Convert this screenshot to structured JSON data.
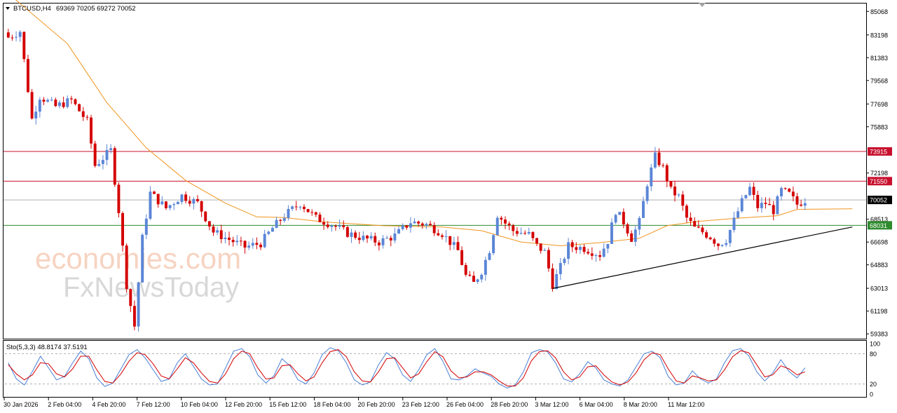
{
  "header": {
    "symbol": "BTCUSD,H4",
    "ohlc": "69369 70205 69272 70052",
    "dropdown_icon": "triangle-down-icon"
  },
  "indicator": {
    "label": "Sto(5,3,3) 48.8174 37.5191"
  },
  "watermark": {
    "line1": "economies.com",
    "line2": "FxNewsToday"
  },
  "colors": {
    "bull": "#5b86d6",
    "bear": "#d40000",
    "ma": "#f0951e",
    "resistance": "#c8102e",
    "support": "#2e8b2e",
    "current": "#b0b0b0",
    "trendline": "#000000",
    "stoch_main": "#4a80d6",
    "stoch_signal": "#d40000"
  },
  "chart_data": [
    {
      "type": "candlestick",
      "symbol": "BTCUSD",
      "timeframe": "H4",
      "y_ticks": [
        85068,
        83198,
        81383,
        79568,
        77698,
        75883,
        72198,
        68513,
        66698,
        64883,
        63013,
        61198,
        59383
      ],
      "ylim": [
        59383,
        85068
      ],
      "x_ticks": [
        "30 Jan 2026",
        "2 Feb 04:00",
        "4 Feb 20:00",
        "7 Feb 12:00",
        "10 Feb 04:00",
        "12 Feb 20:00",
        "15 Feb 12:00",
        "18 Feb 04:00",
        "20 Feb 20:00",
        "23 Feb 12:00",
        "26 Feb 04:00",
        "28 Feb 20:00",
        "3 Mar 12:00",
        "6 Mar 04:00",
        "8 Mar 20:00",
        "11 Mar 12:00"
      ],
      "levels": [
        {
          "label": "73915",
          "value": 73915,
          "role": "resistance"
        },
        {
          "label": "71550",
          "value": 71550,
          "role": "resistance"
        },
        {
          "label": "70052",
          "value": 70052,
          "role": "current"
        },
        {
          "label": "68031",
          "value": 68031,
          "role": "support"
        }
      ],
      "trendline": {
        "from": {
          "bar": 138,
          "price": 63000
        },
        "to": {
          "bar": 214,
          "price": 67900
        }
      },
      "moving_average_path": [
        [
          0,
          86500
        ],
        [
          15,
          82500
        ],
        [
          25,
          77800
        ],
        [
          35,
          74200
        ],
        [
          45,
          71600
        ],
        [
          55,
          69800
        ],
        [
          63,
          68700
        ],
        [
          70,
          68650
        ],
        [
          80,
          68300
        ],
        [
          95,
          68000
        ],
        [
          110,
          67900
        ],
        [
          120,
          67600
        ],
        [
          130,
          66700
        ],
        [
          140,
          66400
        ],
        [
          150,
          66650
        ],
        [
          160,
          67000
        ],
        [
          167,
          68000
        ],
        [
          175,
          68350
        ],
        [
          185,
          68600
        ],
        [
          195,
          68800
        ],
        [
          200,
          69300
        ],
        [
          214,
          69350
        ]
      ],
      "price_path": [
        [
          0,
          83000
        ],
        [
          3,
          83500
        ],
        [
          6,
          76500
        ],
        [
          8,
          78300
        ],
        [
          12,
          77500
        ],
        [
          16,
          78000
        ],
        [
          20,
          76300
        ],
        [
          22,
          72800
        ],
        [
          26,
          74000
        ],
        [
          28,
          69200
        ],
        [
          30,
          63300
        ],
        [
          32,
          60000
        ],
        [
          34,
          67000
        ],
        [
          36,
          70600
        ],
        [
          40,
          69400
        ],
        [
          44,
          70400
        ],
        [
          48,
          69800
        ],
        [
          52,
          67500
        ],
        [
          56,
          66900
        ],
        [
          60,
          66300
        ],
        [
          64,
          66600
        ],
        [
          67,
          67800
        ],
        [
          70,
          68800
        ],
        [
          74,
          69800
        ],
        [
          78,
          68600
        ],
        [
          82,
          68100
        ],
        [
          86,
          67400
        ],
        [
          90,
          67000
        ],
        [
          94,
          66700
        ],
        [
          98,
          67200
        ],
        [
          102,
          68300
        ],
        [
          106,
          68100
        ],
        [
          110,
          67400
        ],
        [
          114,
          66000
        ],
        [
          116,
          64000
        ],
        [
          118,
          63400
        ],
        [
          120,
          64400
        ],
        [
          122,
          66100
        ],
        [
          124,
          68900
        ],
        [
          126,
          68200
        ],
        [
          128,
          67600
        ],
        [
          132,
          67300
        ],
        [
          134,
          66400
        ],
        [
          136,
          65900
        ],
        [
          138,
          63300
        ],
        [
          140,
          64700
        ],
        [
          142,
          66400
        ],
        [
          146,
          66200
        ],
        [
          150,
          65700
        ],
        [
          152,
          66800
        ],
        [
          154,
          69200
        ],
        [
          156,
          68300
        ],
        [
          158,
          67000
        ],
        [
          160,
          68300
        ],
        [
          162,
          71400
        ],
        [
          164,
          73500
        ],
        [
          166,
          72600
        ],
        [
          168,
          70800
        ],
        [
          170,
          70300
        ],
        [
          172,
          68600
        ],
        [
          174,
          67800
        ],
        [
          176,
          67500
        ],
        [
          178,
          67100
        ],
        [
          180,
          66500
        ],
        [
          182,
          66900
        ],
        [
          184,
          68400
        ],
        [
          186,
          69900
        ],
        [
          188,
          71000
        ],
        [
          190,
          69500
        ],
        [
          192,
          69800
        ],
        [
          194,
          69200
        ],
        [
          196,
          70800
        ],
        [
          198,
          70500
        ],
        [
          200,
          69700
        ],
        [
          202,
          70052
        ]
      ]
    },
    {
      "type": "line",
      "name": "Sto(5,3,3)",
      "values_label": [
        "48.8174",
        "37.5191"
      ],
      "ylim": [
        0,
        100
      ],
      "y_ticks": [
        100,
        80,
        20,
        0
      ],
      "levels": [
        80,
        20
      ],
      "series": [
        {
          "role": "main",
          "values": [
            62,
            30,
            18,
            45,
            75,
            52,
            28,
            35,
            62,
            85,
            70,
            32,
            15,
            22,
            50,
            78,
            88,
            72,
            48,
            25,
            30,
            62,
            80,
            55,
            30,
            18,
            20,
            52,
            85,
            90,
            74,
            38,
            22,
            36,
            70,
            56,
            28,
            20,
            42,
            78,
            92,
            86,
            62,
            28,
            18,
            24,
            58,
            82,
            70,
            38,
            25,
            48,
            78,
            90,
            65,
            30,
            28,
            36,
            50,
            42,
            35,
            20,
            12,
            18,
            44,
            82,
            88,
            84,
            62,
            30,
            24,
            40,
            64,
            52,
            28,
            20,
            16,
            28,
            54,
            80,
            85,
            72,
            35,
            18,
            22,
            46,
            30,
            22,
            30,
            62,
            86,
            90,
            76,
            44,
            26,
            42,
            68,
            45,
            32,
            52
          ]
        },
        {
          "role": "signal",
          "values": [
            58,
            40,
            28,
            38,
            62,
            60,
            40,
            34,
            50,
            75,
            75,
            48,
            25,
            22,
            40,
            65,
            82,
            78,
            60,
            36,
            30,
            50,
            72,
            62,
            42,
            25,
            22,
            40,
            70,
            85,
            80,
            52,
            30,
            32,
            56,
            58,
            40,
            26,
            34,
            62,
            84,
            88,
            74,
            44,
            26,
            24,
            44,
            70,
            72,
            52,
            32,
            40,
            64,
            84,
            74,
            46,
            32,
            34,
            44,
            44,
            38,
            26,
            16,
            16,
            32,
            66,
            84,
            86,
            72,
            44,
            28,
            34,
            54,
            56,
            38,
            24,
            18,
            24,
            42,
            68,
            82,
            78,
            50,
            26,
            22,
            36,
            32,
            26,
            28,
            48,
            74,
            86,
            82,
            58,
            34,
            38,
            56,
            50,
            38,
            44
          ]
        }
      ]
    }
  ]
}
